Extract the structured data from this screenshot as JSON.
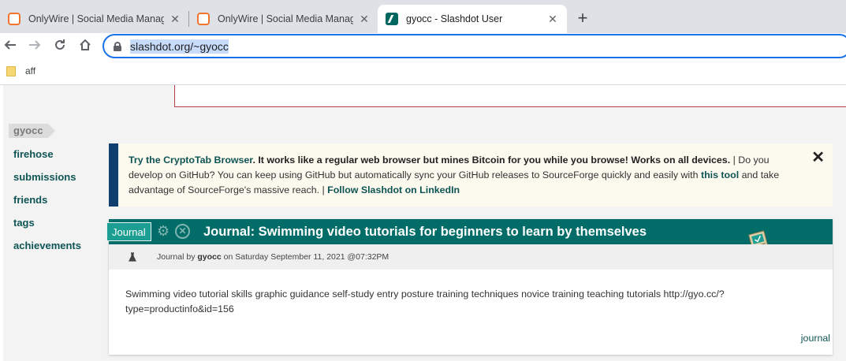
{
  "browser": {
    "tabs": [
      {
        "title": "OnlyWire | Social Media Manage",
        "icon": "onlywire-icon",
        "active": false
      },
      {
        "title": "OnlyWire | Social Media Manage",
        "icon": "onlywire-icon",
        "active": false
      },
      {
        "title": "gyocc - Slashdot User",
        "icon": "slashdot-icon",
        "active": true
      }
    ],
    "new_tab_glyph": "+",
    "close_glyph": "✕",
    "url": "slashdot.org/~gyocc",
    "bookmarks": [
      {
        "label": "aff",
        "icon": "folder-icon"
      }
    ]
  },
  "sidebar": {
    "username": "gyocc",
    "items": [
      {
        "label": "firehose"
      },
      {
        "label": "submissions"
      },
      {
        "label": "friends"
      },
      {
        "label": "tags"
      },
      {
        "label": "achievements"
      }
    ]
  },
  "notice": {
    "link1": "Try the CryptoTab Browser",
    "bold1": ". It works like a regular web browser but mines Bitcoin for you while you browse! Works on all devices.",
    "sep1": " | ",
    "text1": "Do you develop on GitHub? You can keep using GitHub but automatically sync your GitHub releases to SourceForge quickly and easily with ",
    "link2": "this tool",
    "text2": " and take advantage of SourceForge's massive reach.",
    "sep2": " | ",
    "link3": "Follow Slashdot on LinkedIn",
    "close": "✕"
  },
  "article": {
    "badge": "Journal",
    "title": "Journal: Swimming video tutorials for beginners to learn by themselves",
    "byline_prefix": "Journal by ",
    "author": "gyocc",
    "byline_suffix": " on Saturday September 11, 2021 @07:32PM",
    "body": "Swimming video tutorial skills graphic guidance self-study entry posture training techniques novice training teaching tutorials http://gyo.cc/?type=productinfo&id=156",
    "footer_link": "journal"
  },
  "colors": {
    "slashdot_teal": "#026d68",
    "link": "#0f5454",
    "notice_bar": "#0f3f6e",
    "omnibox_focus": "#1a73e8"
  }
}
